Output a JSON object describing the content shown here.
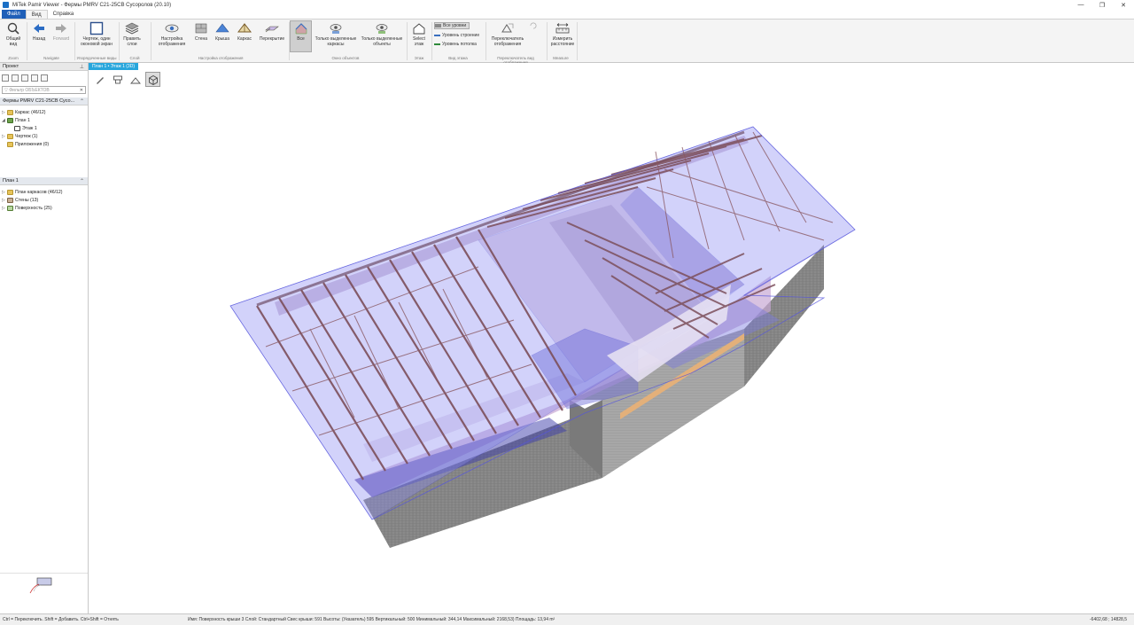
{
  "window": {
    "title": "MiTek Pamir Viewer - Фермы PMRV C21-25CB Сусоролов (20.10)",
    "minimize": "—",
    "maximize": "❐",
    "close": "✕"
  },
  "tabs": [
    {
      "label": "Файл"
    },
    {
      "label": "Вид"
    },
    {
      "label": "Справка"
    }
  ],
  "ribbon": {
    "general_view": "Общий\nвид",
    "back": "Назад",
    "forward": "Forward",
    "drawing_one_window": "Чертеж, один\nоконовой экран",
    "edit_layers": "Править\nслои",
    "display_settings": "Настройка\nотображения",
    "wall": "Стена",
    "roof": "Крыша",
    "frame": "Каркас",
    "floor": "Перекрытие",
    "all": "Все",
    "only_selected_frames": "Только выделенные\nкаркасы",
    "only_selected_objects": "Только выделенные\nобъекты",
    "select_storey": "Select\nэтаж",
    "all_levels": "Все уровни",
    "level_construction": "Уровень строение",
    "level_floor": "Уровень потолка",
    "switch_display_type": "Переключатель\nотображения",
    "measure_distance": "Измерить\nрасстояние",
    "groups": {
      "zoom": "Zoom",
      "navigate": "Navigate",
      "arranged_views": "Упорядоченные виды",
      "layer": "Слой",
      "display_settings": "Настройка отображения",
      "only_objects": "Окно объектов",
      "floor": "Этаж",
      "view_level": "Вид этажа",
      "switch_display": "Переключатель вид отображения",
      "measure": "Measure"
    }
  },
  "left_panel": {
    "project_header": "Проект",
    "filter_placeholder": "Фильтр ОБЪЕКТОВ",
    "project_name": "Фермы PMRV C21-25CB Сусо...",
    "tree": [
      {
        "label": "Каркас (46/12)"
      },
      {
        "label": "План 1"
      },
      {
        "label": "Этаж 1"
      },
      {
        "label": "Чертеж (1)"
      },
      {
        "label": "Приложения (0)"
      }
    ],
    "plan_header": "План 1",
    "plan_tree": [
      {
        "label": "План каркасов (46/12)"
      },
      {
        "label": "Стены (13)"
      },
      {
        "label": "Поверхность (25)"
      }
    ]
  },
  "viewport": {
    "tab_label": "План 1 • Этаж 1 (3D)"
  },
  "status": {
    "hint": "Ctrl = Переключить. Shift = Добавить. Ctrl+Shift = Отнять",
    "info": "Имя: Поверхность крыши 3  Слой: Стандартный  Свес крыши: 591  Высоты: (Указатель) 595 Вертикальный: 500 Минимальный: 344,14 Максимальный: 2168,53)  Площадь: 13,94 m²",
    "coords": "-6402,68 ; 14828,5"
  },
  "colors": {
    "accent_blue": "#1f5fb8",
    "tab_cyan": "#28a6dc",
    "roof_plane": "#8e8ef0",
    "truss": "#8c5a63",
    "wall": "#8f8f8f"
  }
}
